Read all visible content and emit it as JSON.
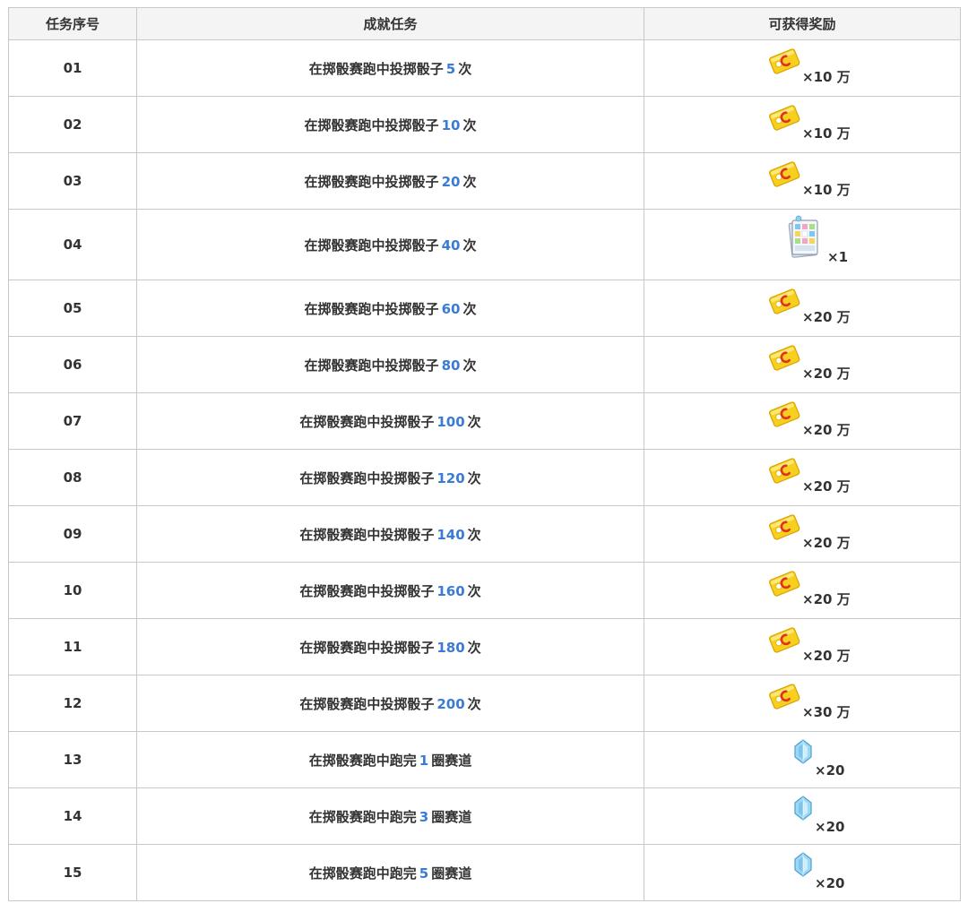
{
  "headers": [
    "任务序号",
    "成就任务",
    "可获得奖励"
  ],
  "colors": {
    "highlight": "#3a7bd5",
    "border": "#c8c8c8",
    "text": "#333333",
    "header_bg": "#f4f4f4"
  },
  "rows": [
    {
      "id": "01",
      "prefix": "在掷骰赛跑中投掷骰子",
      "num": "5",
      "suffix": "次",
      "reward_icon": "coin-card-icon",
      "qty": "×10 万"
    },
    {
      "id": "02",
      "prefix": "在掷骰赛跑中投掷骰子",
      "num": "10",
      "suffix": "次",
      "reward_icon": "coin-card-icon",
      "qty": "×10 万"
    },
    {
      "id": "03",
      "prefix": "在掷骰赛跑中投掷骰子",
      "num": "20",
      "suffix": "次",
      "reward_icon": "coin-card-icon",
      "qty": "×10 万"
    },
    {
      "id": "04",
      "prefix": "在掷骰赛跑中投掷骰子",
      "num": "40",
      "suffix": "次",
      "reward_icon": "game-board-icon",
      "qty": "×1"
    },
    {
      "id": "05",
      "prefix": "在掷骰赛跑中投掷骰子",
      "num": "60",
      "suffix": "次",
      "reward_icon": "coin-card-icon",
      "qty": "×20 万"
    },
    {
      "id": "06",
      "prefix": "在掷骰赛跑中投掷骰子",
      "num": "80",
      "suffix": "次",
      "reward_icon": "coin-card-icon",
      "qty": "×20 万"
    },
    {
      "id": "07",
      "prefix": "在掷骰赛跑中投掷骰子",
      "num": "100",
      "suffix": "次",
      "reward_icon": "coin-card-icon",
      "qty": "×20 万"
    },
    {
      "id": "08",
      "prefix": "在掷骰赛跑中投掷骰子",
      "num": "120",
      "suffix": "次",
      "reward_icon": "coin-card-icon",
      "qty": "×20 万"
    },
    {
      "id": "09",
      "prefix": "在掷骰赛跑中投掷骰子",
      "num": "140",
      "suffix": "次",
      "reward_icon": "coin-card-icon",
      "qty": "×20 万"
    },
    {
      "id": "10",
      "prefix": "在掷骰赛跑中投掷骰子",
      "num": "160",
      "suffix": "次",
      "reward_icon": "coin-card-icon",
      "qty": "×20 万"
    },
    {
      "id": "11",
      "prefix": "在掷骰赛跑中投掷骰子",
      "num": "180",
      "suffix": "次",
      "reward_icon": "coin-card-icon",
      "qty": "×20 万"
    },
    {
      "id": "12",
      "prefix": "在掷骰赛跑中投掷骰子",
      "num": "200",
      "suffix": "次",
      "reward_icon": "coin-card-icon",
      "qty": "×30 万"
    },
    {
      "id": "13",
      "prefix": "在掷骰赛跑中跑完",
      "num": "1",
      "suffix": "圈赛道",
      "reward_icon": "crystal-icon",
      "qty": "×20"
    },
    {
      "id": "14",
      "prefix": "在掷骰赛跑中跑完",
      "num": "3",
      "suffix": "圈赛道",
      "reward_icon": "crystal-icon",
      "qty": "×20"
    },
    {
      "id": "15",
      "prefix": "在掷骰赛跑中跑完",
      "num": "5",
      "suffix": "圈赛道",
      "reward_icon": "crystal-icon",
      "qty": "×20"
    }
  ]
}
